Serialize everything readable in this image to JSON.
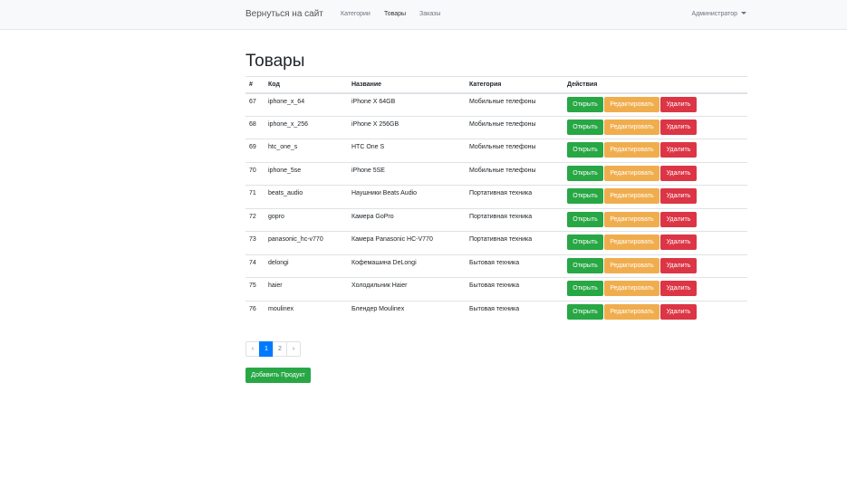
{
  "navbar": {
    "brand": "Вернуться на сайт",
    "links": [
      "Категории",
      "Товары",
      "Заказы"
    ],
    "admin": "Администратор"
  },
  "title": "Товары",
  "table": {
    "headers": [
      "#",
      "Код",
      "Название",
      "Категория",
      "Действия"
    ],
    "rows": [
      {
        "id": "67",
        "code": "iphone_x_64",
        "name": "iPhone X 64GB",
        "category": "Мобильные телефоны"
      },
      {
        "id": "68",
        "code": "iphone_x_256",
        "name": "iPhone X 256GB",
        "category": "Мобильные телефоны"
      },
      {
        "id": "69",
        "code": "htc_one_s",
        "name": "HTC One S",
        "category": "Мобильные телефоны"
      },
      {
        "id": "70",
        "code": "iphone_5se",
        "name": "iPhone 5SE",
        "category": "Мобильные телефоны"
      },
      {
        "id": "71",
        "code": "beats_audio",
        "name": "Наушники Beats Audio",
        "category": "Портативная техника"
      },
      {
        "id": "72",
        "code": "gopro",
        "name": "Камера GoPro",
        "category": "Портативная техника"
      },
      {
        "id": "73",
        "code": "panasonic_hc-v770",
        "name": "Камера Panasonic HC-V770",
        "category": "Портативная техника"
      },
      {
        "id": "74",
        "code": "delongi",
        "name": "Кофемашина DeLongi",
        "category": "Бытовая техника"
      },
      {
        "id": "75",
        "code": "haier",
        "name": "Холодильник Haier",
        "category": "Бытовая техника"
      },
      {
        "id": "76",
        "code": "moulinex",
        "name": "Блендер Moulinex",
        "category": "Бытовая техника"
      }
    ],
    "actions": {
      "open": "Открыть",
      "edit": "Редактировать",
      "delete": "Удалить"
    }
  },
  "pagination": {
    "prev": "‹",
    "pages": [
      "1",
      "2"
    ],
    "current": "1",
    "next": "›"
  },
  "add_button": "Добавить Продукт"
}
